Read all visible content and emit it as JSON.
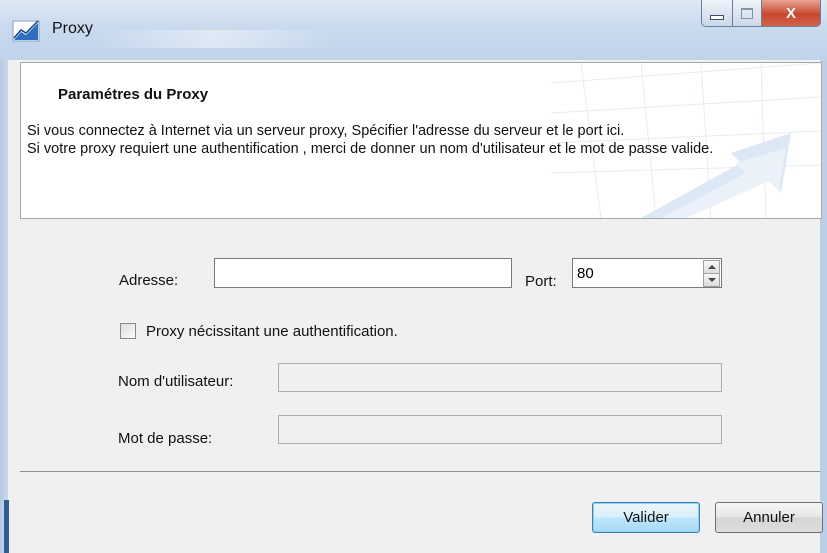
{
  "window": {
    "title": "Proxy",
    "icon": "chart-icon",
    "controls": {
      "minimize": "minimize-icon",
      "maximize": "maximize-icon",
      "close": "close-icon",
      "close_glyph": "X"
    }
  },
  "header": {
    "title": "Paramétres du Proxy",
    "description_line1": "Si vous connectez à Internet via un serveur proxy, Spécifier l'adresse du serveur et le port ici.",
    "description_line2": "Si votre proxy requiert une authentification , merci de donner un nom d'utilisateur et le mot de passe valide."
  },
  "form": {
    "address_label": "Adresse:",
    "address_value": "",
    "port_label": "Port:",
    "port_value": "80",
    "auth_checkbox_label": "Proxy nécissitant une authentification.",
    "auth_checked": false,
    "username_label": "Nom d'utilisateur:",
    "username_value": "",
    "password_label": "Mot de passe:",
    "password_value": ""
  },
  "buttons": {
    "ok_label": "Valider",
    "cancel_label": "Annuler"
  },
  "colors": {
    "titlebar": "#c9daee",
    "close_button": "#c6482e",
    "primary_button_border": "#3c7fb1"
  }
}
